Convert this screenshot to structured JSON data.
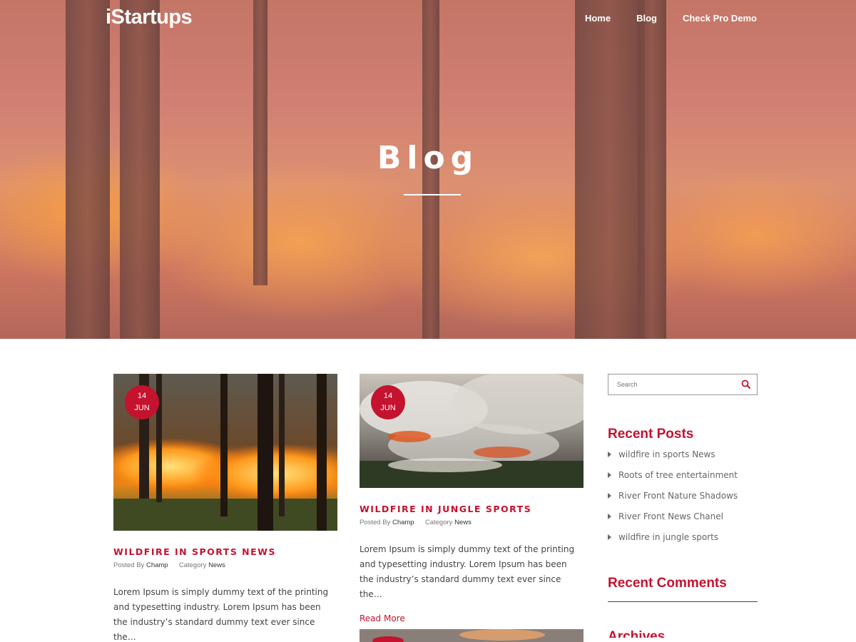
{
  "header": {
    "logo": "iStartups",
    "nav": [
      "Home",
      "Blog",
      "Check Pro Demo"
    ]
  },
  "hero": {
    "title": "Blog"
  },
  "posts": [
    {
      "day": "14",
      "month": "JUN",
      "title": "WILDFIRE IN SPORTS NEWS",
      "posted_by_label": "Posted By",
      "author": "Champ",
      "category_label": "Category",
      "category": "News",
      "excerpt": "Lorem Ipsum is simply dummy text of the printing and typesetting industry. Lorem Ipsum has been the industry’s standard dummy text ever since the…"
    },
    {
      "day": "14",
      "month": "JUN",
      "title": "WILDFIRE IN JUNGLE SPORTS",
      "posted_by_label": "Posted By",
      "author": "Champ",
      "category_label": "Category",
      "category": "News",
      "excerpt": "Lorem Ipsum is simply dummy text of the printing and typesetting industry. Lorem Ipsum has been the industry’s standard dummy text ever since the…",
      "read_more": "Read More"
    }
  ],
  "sidebar": {
    "search_placeholder": "Search",
    "recent_posts_title": "Recent Posts",
    "recent_posts": [
      "wildfire in sports News",
      "Roots of tree entertainment",
      "River Front Nature Shadows",
      "River Front News Chanel",
      "wildfire in jungle sports"
    ],
    "recent_comments_title": "Recent Comments",
    "archives_title": "Archives"
  },
  "colors": {
    "accent": "#c4122f"
  }
}
